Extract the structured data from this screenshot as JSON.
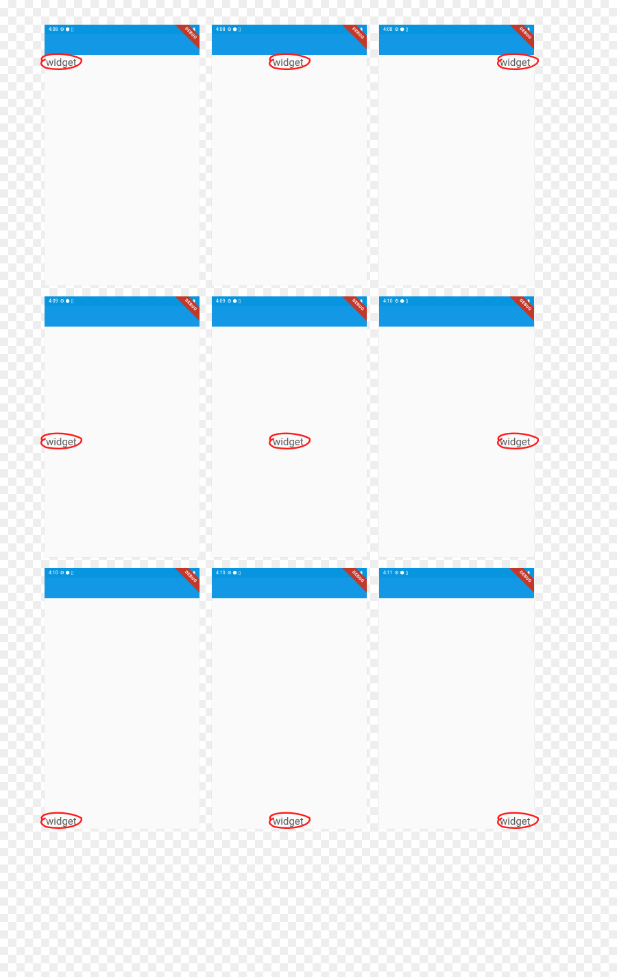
{
  "widget_label": "widget",
  "debug_label": "DEBUG",
  "status_icons": "⚙ ⬢ ▯",
  "status_right_icons": "▲ ◢ ▮",
  "screens": [
    {
      "time": "4:08",
      "valign": "top",
      "halign": "left"
    },
    {
      "time": "4:08",
      "valign": "top",
      "halign": "center"
    },
    {
      "time": "4:08",
      "valign": "top",
      "halign": "right"
    },
    {
      "time": "4:09",
      "valign": "middle",
      "halign": "left"
    },
    {
      "time": "4:09",
      "valign": "middle",
      "halign": "center"
    },
    {
      "time": "4:10",
      "valign": "middle",
      "halign": "right"
    },
    {
      "time": "4:10",
      "valign": "bottom",
      "halign": "left"
    },
    {
      "time": "4:10",
      "valign": "bottom",
      "halign": "center"
    },
    {
      "time": "4:11",
      "valign": "bottom",
      "halign": "right"
    }
  ]
}
